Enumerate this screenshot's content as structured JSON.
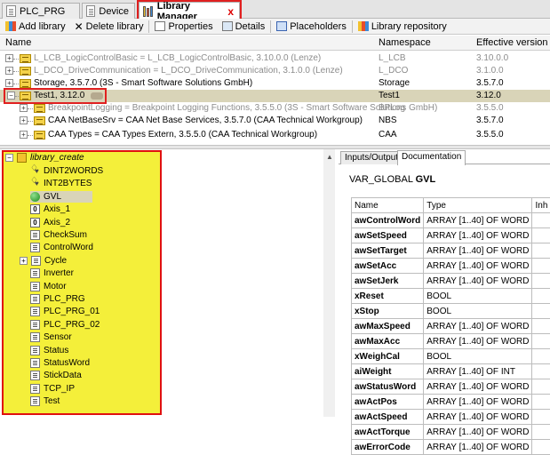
{
  "tabs": [
    {
      "label": "PLC_PRG",
      "icon": "document-icon"
    },
    {
      "label": "Device",
      "icon": "document-icon"
    },
    {
      "label": "Library Manager",
      "icon": "library-icon",
      "close": "x"
    }
  ],
  "toolbar": {
    "add_library": "Add library",
    "delete_library": "Delete library",
    "properties": "Properties",
    "details": "Details",
    "placeholders": "Placeholders",
    "library_repository": "Library repository"
  },
  "libtable": {
    "headers": {
      "name": "Name",
      "namespace": "Namespace",
      "version": "Effective version"
    },
    "rows": [
      {
        "name": "L_LCB_LogicControlBasic = L_LCB_LogicControlBasic, 3.10.0.0 (Lenze)",
        "namespace": "L_LCB",
        "version": "3.10.0.0",
        "gray": true
      },
      {
        "name": "L_DCO_DriveCommunication = L_DCO_DriveCommunication, 3.1.0.0 (Lenze)",
        "namespace": "L_DCO",
        "version": "3.1.0.0",
        "gray": true
      },
      {
        "name": "Storage, 3.5.7.0 (3S - Smart Software Solutions GmbH)",
        "namespace": "Storage",
        "version": "3.5.7.0",
        "gray": false
      },
      {
        "name": "Test1, 3.12.0",
        "namespace": "Test1",
        "version": "3.12.0",
        "gray": false
      },
      {
        "name": "BreakpointLogging = Breakpoint Logging Functions, 3.5.5.0 (3S - Smart Software Solutions GmbH)",
        "namespace": "BPLog",
        "version": "3.5.5.0",
        "gray": true
      },
      {
        "name": "CAA NetBaseSrv = CAA Net Base Services, 3.5.7.0 (CAA Technical Workgroup)",
        "namespace": "NBS",
        "version": "3.5.7.0",
        "gray": false
      },
      {
        "name": "CAA Types = CAA Types Extern, 3.5.5.0 (CAA Technical Workgroup)",
        "namespace": "CAA",
        "version": "3.5.5.0",
        "gray": false
      }
    ]
  },
  "tree": {
    "root": "library_create",
    "items": [
      {
        "label": "DINT2WORDS",
        "icon": "function-icon"
      },
      {
        "label": "INT2BYTES",
        "icon": "function-icon"
      },
      {
        "label": "GVL",
        "icon": "gvl-icon"
      },
      {
        "label": "Axis_1",
        "icon": "dut-icon"
      },
      {
        "label": "Axis_2",
        "icon": "dut-icon"
      },
      {
        "label": "CheckSum",
        "icon": "pou-icon"
      },
      {
        "label": "ControlWord",
        "icon": "pou-icon"
      },
      {
        "label": "Cycle",
        "icon": "pou-icon",
        "expandable": true
      },
      {
        "label": "Inverter",
        "icon": "pou-icon"
      },
      {
        "label": "Motor",
        "icon": "pou-icon"
      },
      {
        "label": "PLC_PRG",
        "icon": "pou-icon"
      },
      {
        "label": "PLC_PRG_01",
        "icon": "pou-icon"
      },
      {
        "label": "PLC_PRG_02",
        "icon": "pou-icon"
      },
      {
        "label": "Sensor",
        "icon": "pou-icon"
      },
      {
        "label": "Status",
        "icon": "pou-icon"
      },
      {
        "label": "StatusWord",
        "icon": "pou-icon"
      },
      {
        "label": "StickData",
        "icon": "pou-icon"
      },
      {
        "label": "TCP_IP",
        "icon": "pou-icon"
      },
      {
        "label": "Test",
        "icon": "pou-icon"
      }
    ]
  },
  "right_tabs": [
    "Inputs/Outputs",
    "Documentation"
  ],
  "doc": {
    "title_prefix": "VAR_GLOBAL",
    "title_name": "GVL",
    "headers": [
      "Name",
      "Type",
      "Inh"
    ],
    "vars": [
      {
        "name": "awControlWord",
        "type": "ARRAY [1..40] OF WORD"
      },
      {
        "name": "awSetSpeed",
        "type": "ARRAY [1..40] OF WORD"
      },
      {
        "name": "awSetTarget",
        "type": "ARRAY [1..40] OF WORD"
      },
      {
        "name": "awSetAcc",
        "type": "ARRAY [1..40] OF WORD"
      },
      {
        "name": "awSetJerk",
        "type": "ARRAY [1..40] OF WORD"
      },
      {
        "name": "xReset",
        "type": "BOOL"
      },
      {
        "name": "xStop",
        "type": "BOOL"
      },
      {
        "name": "awMaxSpeed",
        "type": "ARRAY [1..40] OF WORD"
      },
      {
        "name": "awMaxAcc",
        "type": "ARRAY [1..40] OF WORD"
      },
      {
        "name": "xWeighCal",
        "type": "BOOL"
      },
      {
        "name": "aiWeight",
        "type": "ARRAY [1..40] OF INT"
      },
      {
        "name": "awStatusWord",
        "type": "ARRAY [1..40] OF WORD"
      },
      {
        "name": "awActPos",
        "type": "ARRAY [1..40] OF WORD"
      },
      {
        "name": "awActSpeed",
        "type": "ARRAY [1..40] OF WORD"
      },
      {
        "name": "awActTorque",
        "type": "ARRAY [1..40] OF WORD"
      },
      {
        "name": "awErrorCode",
        "type": "ARRAY [1..40] OF WORD"
      }
    ]
  },
  "colors": {
    "highlight": "#e02020",
    "tree_bg": "#f4ef3a"
  }
}
